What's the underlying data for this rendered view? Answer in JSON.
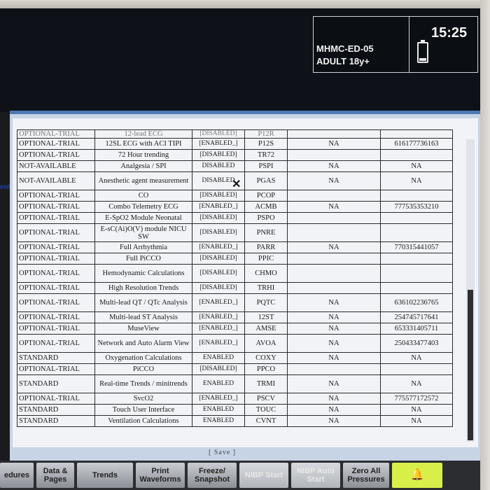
{
  "header": {
    "bed_label": "MHMC-ED-05",
    "patient_type": "ADULT 18y+",
    "clock": "15:25"
  },
  "side_fragment": "ent",
  "options_table": {
    "rows": [
      {
        "status": "OPTIONAL-TRIAL",
        "name": "12-lead ECG",
        "state": "[DISABLED]",
        "code": "P12R",
        "na": "",
        "key": ""
      },
      {
        "status": "OPTIONAL-TRIAL",
        "name": "12SL ECG with ACI TIPI",
        "state": "[ENABLED_]",
        "code": "P12S",
        "na": "NA",
        "key": "616177736163"
      },
      {
        "status": "OPTIONAL-TRIAL",
        "name": "72 Hour trending",
        "state": "[DISABLED]",
        "code": "TR72",
        "na": "",
        "key": ""
      },
      {
        "status": "NOT-AVAILABLE",
        "name": "Analgesia / SPI",
        "state": "DISABLED",
        "code": "PSPI",
        "na": "NA",
        "key": "NA"
      },
      {
        "status": "NOT-AVAILABLE",
        "name": "Anesthetic agent measurement",
        "state": "DISABLED",
        "code": "PGAS",
        "na": "NA",
        "key": "NA"
      },
      {
        "status": "OPTIONAL-TRIAL",
        "name": "CO",
        "state": "[DISABLED]",
        "code": "PCOP",
        "na": "",
        "key": ""
      },
      {
        "status": "OPTIONAL-TRIAL",
        "name": "Combo Telemetry ECG",
        "state": "[ENABLED_]",
        "code": "ACMB",
        "na": "NA",
        "key": "777535353210"
      },
      {
        "status": "OPTIONAL-TRIAL",
        "name": "E-SpO2 Module Neonatal",
        "state": "[DISABLED]",
        "code": "PSPO",
        "na": "",
        "key": ""
      },
      {
        "status": "OPTIONAL-TRIAL",
        "name": "E-sC(Ai)O(V) module NICU SW",
        "state": "[DISABLED]",
        "code": "PNRE",
        "na": "",
        "key": ""
      },
      {
        "status": "OPTIONAL-TRIAL",
        "name": "Full Arrhythmia",
        "state": "[ENABLED_]",
        "code": "PARR",
        "na": "NA",
        "key": "770315441057"
      },
      {
        "status": "OPTIONAL-TRIAL",
        "name": "Full PiCCO",
        "state": "[DISABLED]",
        "code": "PPIC",
        "na": "",
        "key": ""
      },
      {
        "status": "OPTIONAL-TRIAL",
        "name": "Hemodynamic Calculations",
        "state": "[DISABLED]",
        "code": "CHMO",
        "na": "",
        "key": ""
      },
      {
        "status": "OPTIONAL-TRIAL",
        "name": "High Resolution Trends",
        "state": "[DISABLED]",
        "code": "TRHI",
        "na": "",
        "key": ""
      },
      {
        "status": "OPTIONAL-TRIAL",
        "name": "Multi-lead QT / QTc Analysis",
        "state": "[ENABLED_]",
        "code": "PQTC",
        "na": "NA",
        "key": "636102236765"
      },
      {
        "status": "OPTIONAL-TRIAL",
        "name": "Multi-lead ST Analysis",
        "state": "[ENABLED_]",
        "code": "12ST",
        "na": "NA",
        "key": "254745717641"
      },
      {
        "status": "OPTIONAL-TRIAL",
        "name": "MuseView",
        "state": "[ENABLED_]",
        "code": "AMSE",
        "na": "NA",
        "key": "653331405711"
      },
      {
        "status": "OPTIONAL-TRIAL",
        "name": "Network and Auto Alarm View",
        "state": "[ENABLED_]",
        "code": "AVOA",
        "na": "NA",
        "key": "250433477403"
      },
      {
        "status": "STANDARD",
        "name": "Oxygenation Calculations",
        "state": "ENABLED",
        "code": "COXY",
        "na": "NA",
        "key": "NA"
      },
      {
        "status": "OPTIONAL-TRIAL",
        "name": "PiCCO",
        "state": "[DISABLED]",
        "code": "PPCO",
        "na": "",
        "key": ""
      },
      {
        "status": "STANDARD",
        "name": "Real-time Trends / minitrends",
        "state": "ENABLED",
        "code": "TRMI",
        "na": "NA",
        "key": "NA"
      },
      {
        "status": "OPTIONAL-TRIAL",
        "name": "SvcO2",
        "state": "[ENABLED_]",
        "code": "PSCV",
        "na": "NA",
        "key": "775577172572"
      },
      {
        "status": "STANDARD",
        "name": "Touch User Interface",
        "state": "ENABLED",
        "code": "TOUC",
        "na": "NA",
        "key": "NA"
      },
      {
        "status": "STANDARD",
        "name": "Ventilation Calculations",
        "state": "ENABLED",
        "code": "CVNT",
        "na": "NA",
        "key": "NA"
      }
    ]
  },
  "dialog": {
    "save_label": "[ Save ]"
  },
  "toolbar": {
    "procedures": "edures",
    "data_pages": "Data & Pages",
    "trends": "Trends",
    "print_waveforms": "Print Waveforms",
    "freeze_snapshot": "Freeze/ Snapshot",
    "nibp_start": "NIBP Start",
    "nibp_auto_start": "NIBP Auto Start",
    "zero_all_pressures": "Zero All Pressures",
    "alarm_icon": "bell-icon"
  }
}
